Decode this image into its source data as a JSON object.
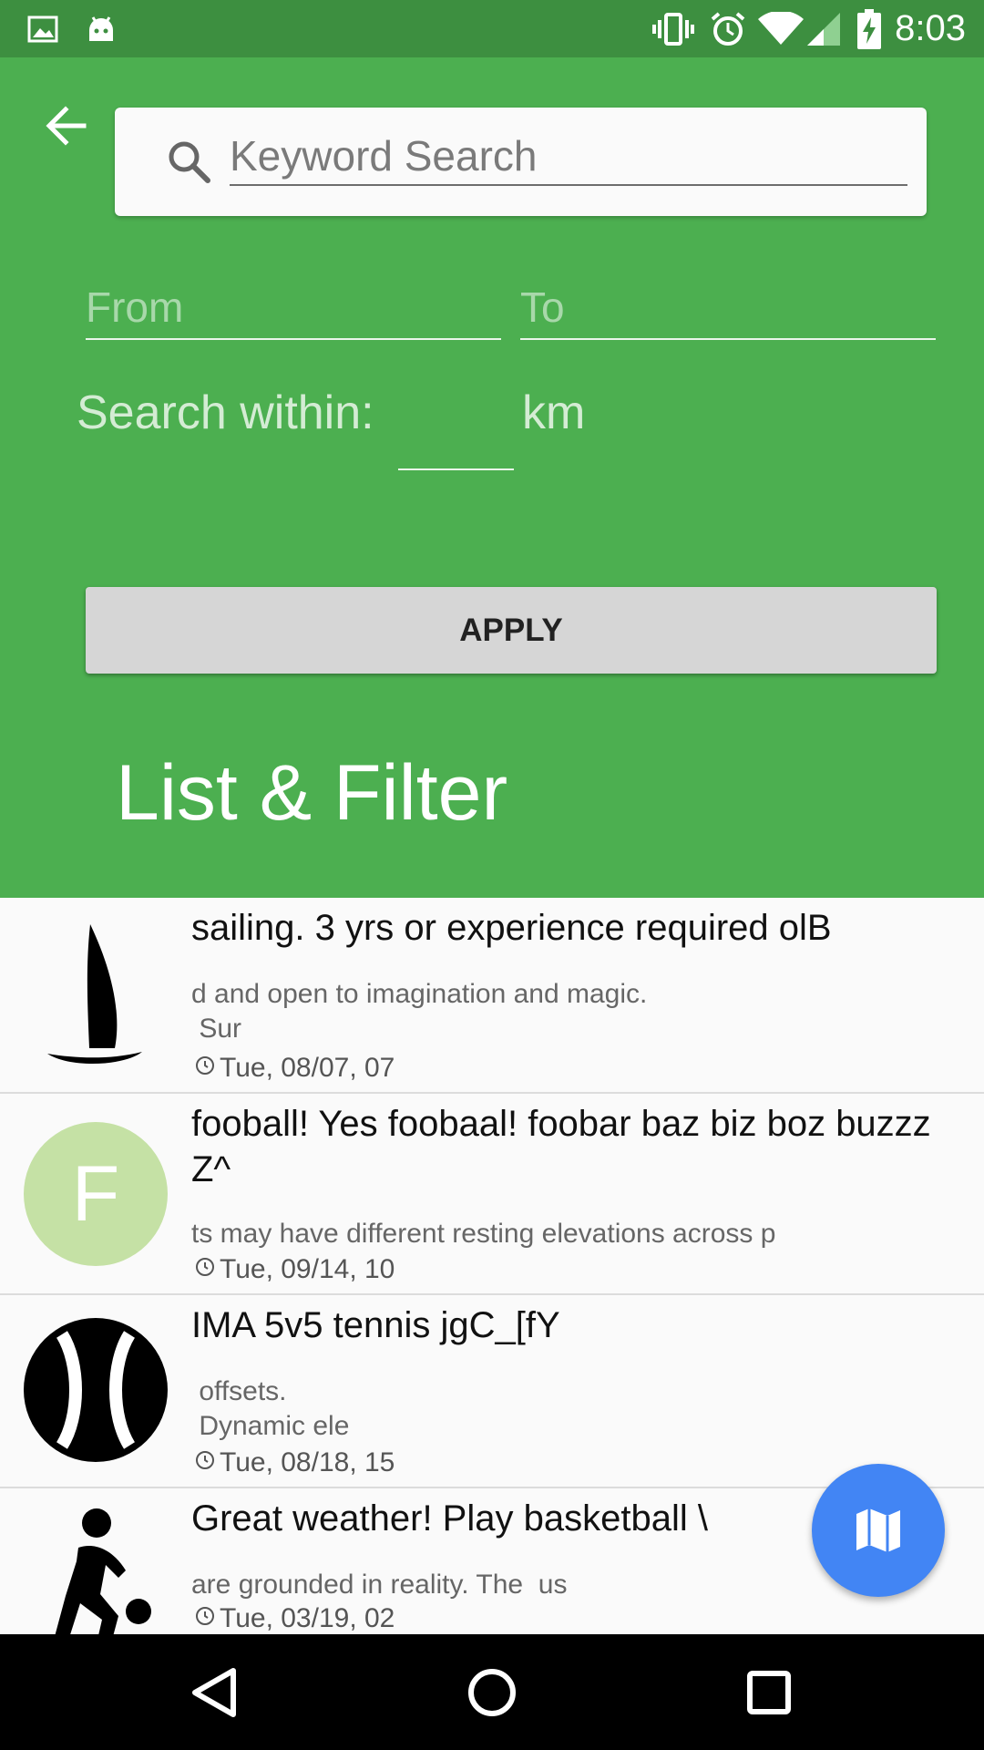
{
  "status_bar": {
    "time": "8:03",
    "icons": [
      "image-icon",
      "android-icon",
      "vibrate-icon",
      "alarm-icon",
      "wifi-icon",
      "signal-icon",
      "battery-charging-icon"
    ]
  },
  "header": {
    "back_icon": "arrow-back-icon",
    "search": {
      "placeholder": "Keyword Search",
      "icon": "search-icon"
    },
    "from_placeholder": "From",
    "to_placeholder": "To",
    "within_label": "Search within:",
    "km_label": "km",
    "apply_label": "APPLY",
    "title": "List & Filter"
  },
  "list": {
    "items": [
      {
        "avatar": "sailboat-icon",
        "title": "sailing. 3 yrs or experience required olB",
        "description": "d and open to imagination and magic.\n Sur",
        "date": "Tue, 08/07, 07"
      },
      {
        "avatar_letter": "F",
        "avatar_color": "#c5e1a5",
        "title": "fooball! Yes foobaal! foobar baz biz boz buzzz Z^",
        "description": "ts may have different resting elevations across p",
        "date": "Tue, 09/14, 10"
      },
      {
        "avatar": "tennis-ball-icon",
        "title": "IMA 5v5 tennis jgC_[fY",
        "description": " offsets.\n Dynamic ele",
        "date": "Tue, 08/18, 15"
      },
      {
        "avatar": "basketball-player-icon",
        "title": "Great weather! Play basketball \\",
        "description": "are grounded in reality. The  us",
        "date": "Tue, 03/19, 02"
      }
    ]
  },
  "fab": {
    "icon": "map-icon"
  },
  "nav_bar": {
    "icons": [
      "back-triangle-icon",
      "home-circle-icon",
      "recents-square-icon"
    ]
  },
  "colors": {
    "primary": "#4caf50",
    "status_bar": "#3d8f40",
    "fab": "#4285f4"
  }
}
